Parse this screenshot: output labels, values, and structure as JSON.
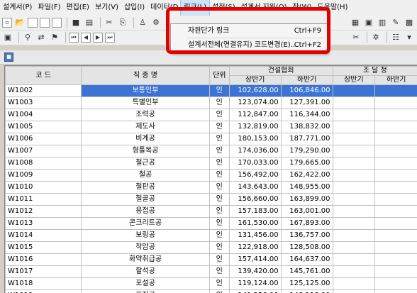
{
  "menubar": {
    "items": [
      {
        "label": "설계서(P)",
        "active": false
      },
      {
        "label": "파일(F)",
        "active": false
      },
      {
        "label": "편집(E)",
        "active": false
      },
      {
        "label": "보기(V)",
        "active": false
      },
      {
        "label": "삽입(I)",
        "active": false
      },
      {
        "label": "데이터(D",
        "active": false
      },
      {
        "label": "링크(L)",
        "active": true
      },
      {
        "label": "설정(S)",
        "active": false
      },
      {
        "label": "설계서 지원(O)",
        "active": false
      },
      {
        "label": "창(W)",
        "active": false
      },
      {
        "label": "도움말(H)",
        "active": false
      }
    ]
  },
  "link_menu": {
    "items": [
      {
        "label": "자원단가 링크",
        "shortcut": "Ctrl+F9"
      },
      {
        "label": "설계서전체(연결유지) 코드변경(E)...",
        "shortcut": "Ctrl+F2"
      }
    ]
  },
  "grid": {
    "headers": {
      "code": "코 드",
      "name": "직 종 명",
      "unit": "단위",
      "group1": "건설협회",
      "group2": "조 달 청",
      "h1": "상반기",
      "h2": "하반기",
      "h3": "상반기",
      "h4": "하반기"
    },
    "rows": [
      {
        "code": "W1002",
        "name": "보통인부",
        "unit": "인",
        "v1": "102,628.00",
        "v2": "106,846.00",
        "selected": true
      },
      {
        "code": "W1003",
        "name": "특별인부",
        "unit": "인",
        "v1": "123,074.00",
        "v2": "127,391.00",
        "selected": false
      },
      {
        "code": "W1004",
        "name": "조력공",
        "unit": "인",
        "v1": "112,847.00",
        "v2": "116,344.00",
        "selected": false
      },
      {
        "code": "W1005",
        "name": "제도사",
        "unit": "인",
        "v1": "132,819.00",
        "v2": "138,832.00",
        "selected": false
      },
      {
        "code": "W1006",
        "name": "비계공",
        "unit": "인",
        "v1": "180,153.00",
        "v2": "187,771.00",
        "selected": false
      },
      {
        "code": "W1007",
        "name": "형틀목공",
        "unit": "인",
        "v1": "174,036.00",
        "v2": "179,290.00",
        "selected": false
      },
      {
        "code": "W1008",
        "name": "철근공",
        "unit": "인",
        "v1": "170,033.00",
        "v2": "179,665.00",
        "selected": false
      },
      {
        "code": "W1009",
        "name": "철공",
        "unit": "인",
        "v1": "156,492.00",
        "v2": "162,422.00",
        "selected": false
      },
      {
        "code": "W1010",
        "name": "철판공",
        "unit": "인",
        "v1": "143,643.00",
        "v2": "148,955.00",
        "selected": false
      },
      {
        "code": "W1011",
        "name": "철골공",
        "unit": "인",
        "v1": "156,660.00",
        "v2": "163,899.00",
        "selected": false
      },
      {
        "code": "W1012",
        "name": "용접공",
        "unit": "인",
        "v1": "157,183.00",
        "v2": "163,001.00",
        "selected": false
      },
      {
        "code": "W1013",
        "name": "콘크리트공",
        "unit": "인",
        "v1": "161,530.00",
        "v2": "167,893.00",
        "selected": false
      },
      {
        "code": "W1014",
        "name": "보링공",
        "unit": "인",
        "v1": "131,456.00",
        "v2": "136,757.00",
        "selected": false
      },
      {
        "code": "W1015",
        "name": "착암공",
        "unit": "인",
        "v1": "122,918.00",
        "v2": "128,508.00",
        "selected": false
      },
      {
        "code": "W1016",
        "name": "화약취급공",
        "unit": "인",
        "v1": "157,414.00",
        "v2": "164,637.00",
        "selected": false
      },
      {
        "code": "W1017",
        "name": "할석공",
        "unit": "인",
        "v1": "139,420.00",
        "v2": "145,761.00",
        "selected": false
      },
      {
        "code": "W1018",
        "name": "포설공",
        "unit": "인",
        "v1": "119,124.00",
        "v2": "125,125.00",
        "selected": false
      },
      {
        "code": "W1019",
        "name": "포장공",
        "unit": "인",
        "v1": "141,226.00",
        "v2": "148,118.00",
        "selected": false
      }
    ]
  },
  "colors": {
    "highlight": "#e30000",
    "selection": "#3b74d4",
    "menu_active": "#cce4f7"
  }
}
